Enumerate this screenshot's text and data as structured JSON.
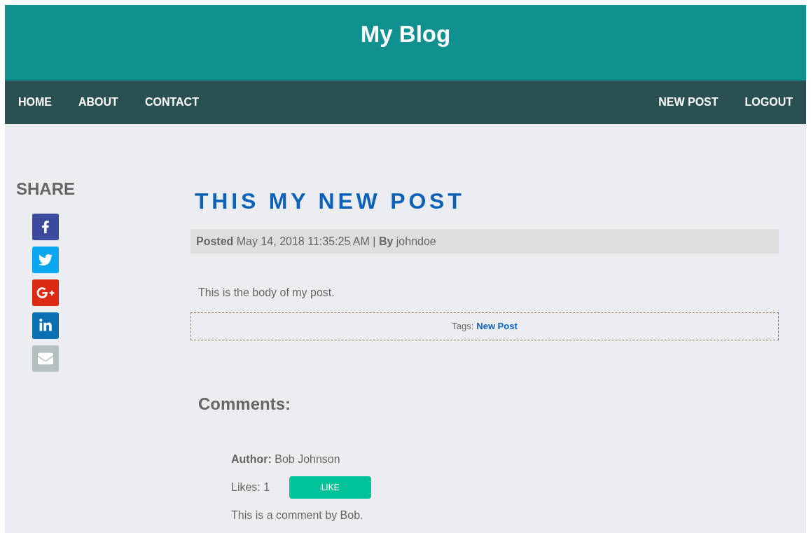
{
  "site_title": "My Blog",
  "nav": {
    "left": [
      "HOME",
      "ABOUT",
      "CONTACT"
    ],
    "right": [
      "NEW POST",
      "LOGOUT"
    ]
  },
  "share": {
    "heading": "SHARE",
    "buttons": [
      {
        "kind": "facebook"
      },
      {
        "kind": "twitter"
      },
      {
        "kind": "googleplus"
      },
      {
        "kind": "linkedin"
      },
      {
        "kind": "email"
      }
    ]
  },
  "post": {
    "title": "THIS MY NEW POST",
    "meta": "**Posted** May 14, 2018 11:35:25 AM | **By** johndoe",
    "body": "This is the body of my post.",
    "tags_label": "Tags:",
    "tags": [
      "New Post"
    ]
  },
  "comments": {
    "heading": "Comments:",
    "items": [
      {
        "author": "**Author:** Bob Johnson",
        "likes": "Likes: 1",
        "like_button": "LIKE",
        "text": "This is a comment by Bob."
      }
    ]
  }
}
